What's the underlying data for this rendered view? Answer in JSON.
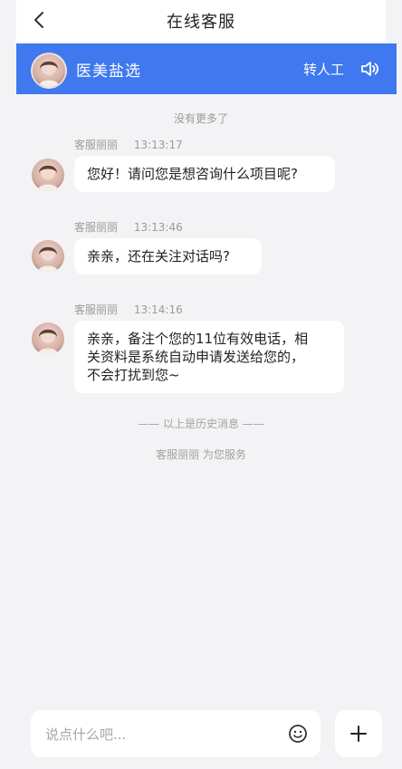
{
  "header": {
    "title": "在线客服",
    "back_icon": "chevron-left-icon"
  },
  "brand": {
    "name": "医美盐选",
    "transfer_label": "转人工",
    "speaker_icon": "speaker-icon",
    "bar_color": "#3f78ef"
  },
  "chat": {
    "no_more_text": "没有更多了",
    "messages": [
      {
        "sender": "客服丽丽",
        "time": "13:13:17",
        "text": "您好！请问您是想咨询什么项目呢?"
      },
      {
        "sender": "客服丽丽",
        "time": "13:13:46",
        "text": "亲亲，还在关注对话吗?"
      },
      {
        "sender": "客服丽丽",
        "time": "13:14:16",
        "lines": [
          "亲亲，备注个您的11位有效电话，相",
          "关资料是系统自动申请发送给您的，",
          "不会打扰到您~"
        ]
      }
    ],
    "history_divider": "—— 以上是历史消息 ——",
    "service_note": "客服丽丽 为您服务"
  },
  "input": {
    "placeholder": "说点什么吧...",
    "emoji_icon": "emoji-icon",
    "plus_icon": "plus-icon"
  }
}
